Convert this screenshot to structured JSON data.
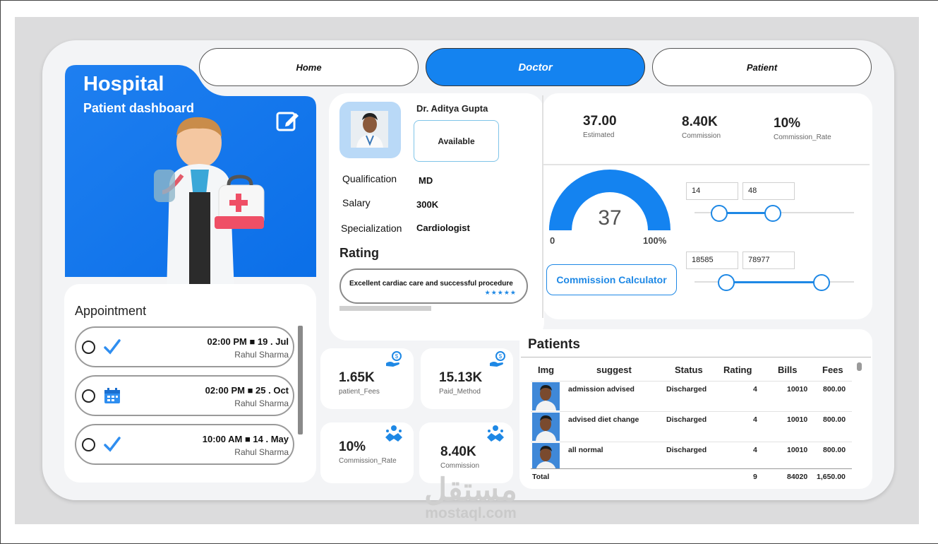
{
  "nav": {
    "tabs": [
      {
        "label": "Home"
      },
      {
        "label": "Doctor"
      },
      {
        "label": "Patient"
      }
    ]
  },
  "hero": {
    "title": "Hospital",
    "subtitle": "Patient dashboard"
  },
  "appointments": {
    "title": "Appointment",
    "items": [
      {
        "time": "02:00 PM  ■  19 . Jul",
        "name": "Rahul Sharma",
        "icon": "checkmark-icon"
      },
      {
        "time": "02:00 PM  ■  25 . Oct",
        "name": "Rahul Sharma",
        "icon": "calendar-icon"
      },
      {
        "time": "10:00 AM  ■  14 . May",
        "name": "Rahul Sharma",
        "icon": "checkmark-icon"
      }
    ]
  },
  "doctor": {
    "name": "Dr. Aditya Gupta",
    "status": "Available",
    "qualification_label": "Qualification",
    "qualification": "MD",
    "salary_label": "Salary",
    "salary": "300K",
    "specialization_label": "Specialization",
    "specialization": "Cardiologist",
    "rating_title": "Rating",
    "review": "Excellent cardiac care and successful procedure",
    "stars": "★★★★★"
  },
  "stats": {
    "estimated": {
      "value": "37.00",
      "label": "Estimated"
    },
    "commission": {
      "value": "8.40K",
      "label": "Commission"
    },
    "commission_rate": {
      "value": "10%",
      "label": "Commission_Rate"
    }
  },
  "gauge": {
    "value": "37",
    "fraction": 0.37,
    "min": "0",
    "max": "100%"
  },
  "calculator": {
    "button_label": "Commission Calculator",
    "range1": {
      "low": "14",
      "high": "48"
    },
    "range2": {
      "low": "18585",
      "high": "78977"
    }
  },
  "kpis": [
    {
      "value": "1.65K",
      "label": "patient_Fees",
      "icon": "money-hand-icon"
    },
    {
      "value": "15.13K",
      "label": "Paid_Method",
      "icon": "money-hand-icon"
    },
    {
      "value": "10%",
      "label": "Commission_Rate",
      "icon": "handshake-icon"
    },
    {
      "value": "8.40K",
      "label": "Commission",
      "icon": "handshake-icon"
    }
  ],
  "patients": {
    "title": "Patients",
    "columns": [
      "Img",
      "suggest",
      "Status",
      "Rating",
      "Bills",
      "Fees"
    ],
    "rows": [
      {
        "suggest": "admission advised",
        "status": "Discharged",
        "rating": "4",
        "bills": "10010",
        "fees": "800.00"
      },
      {
        "suggest": "advised diet change",
        "status": "Discharged",
        "rating": "4",
        "bills": "10010",
        "fees": "800.00"
      },
      {
        "suggest": "all normal",
        "status": "Discharged",
        "rating": "4",
        "bills": "10010",
        "fees": "800.00"
      }
    ],
    "total": {
      "label": "Total",
      "rating": "9",
      "bills": "84020",
      "fees": "1,650.00"
    }
  },
  "watermark": {
    "arabic": "مستقل",
    "latin": "mostaql.com"
  },
  "colors": {
    "accent": "#1483f0",
    "board": "#f3f4f6",
    "canvas": "#dcdcdd"
  }
}
